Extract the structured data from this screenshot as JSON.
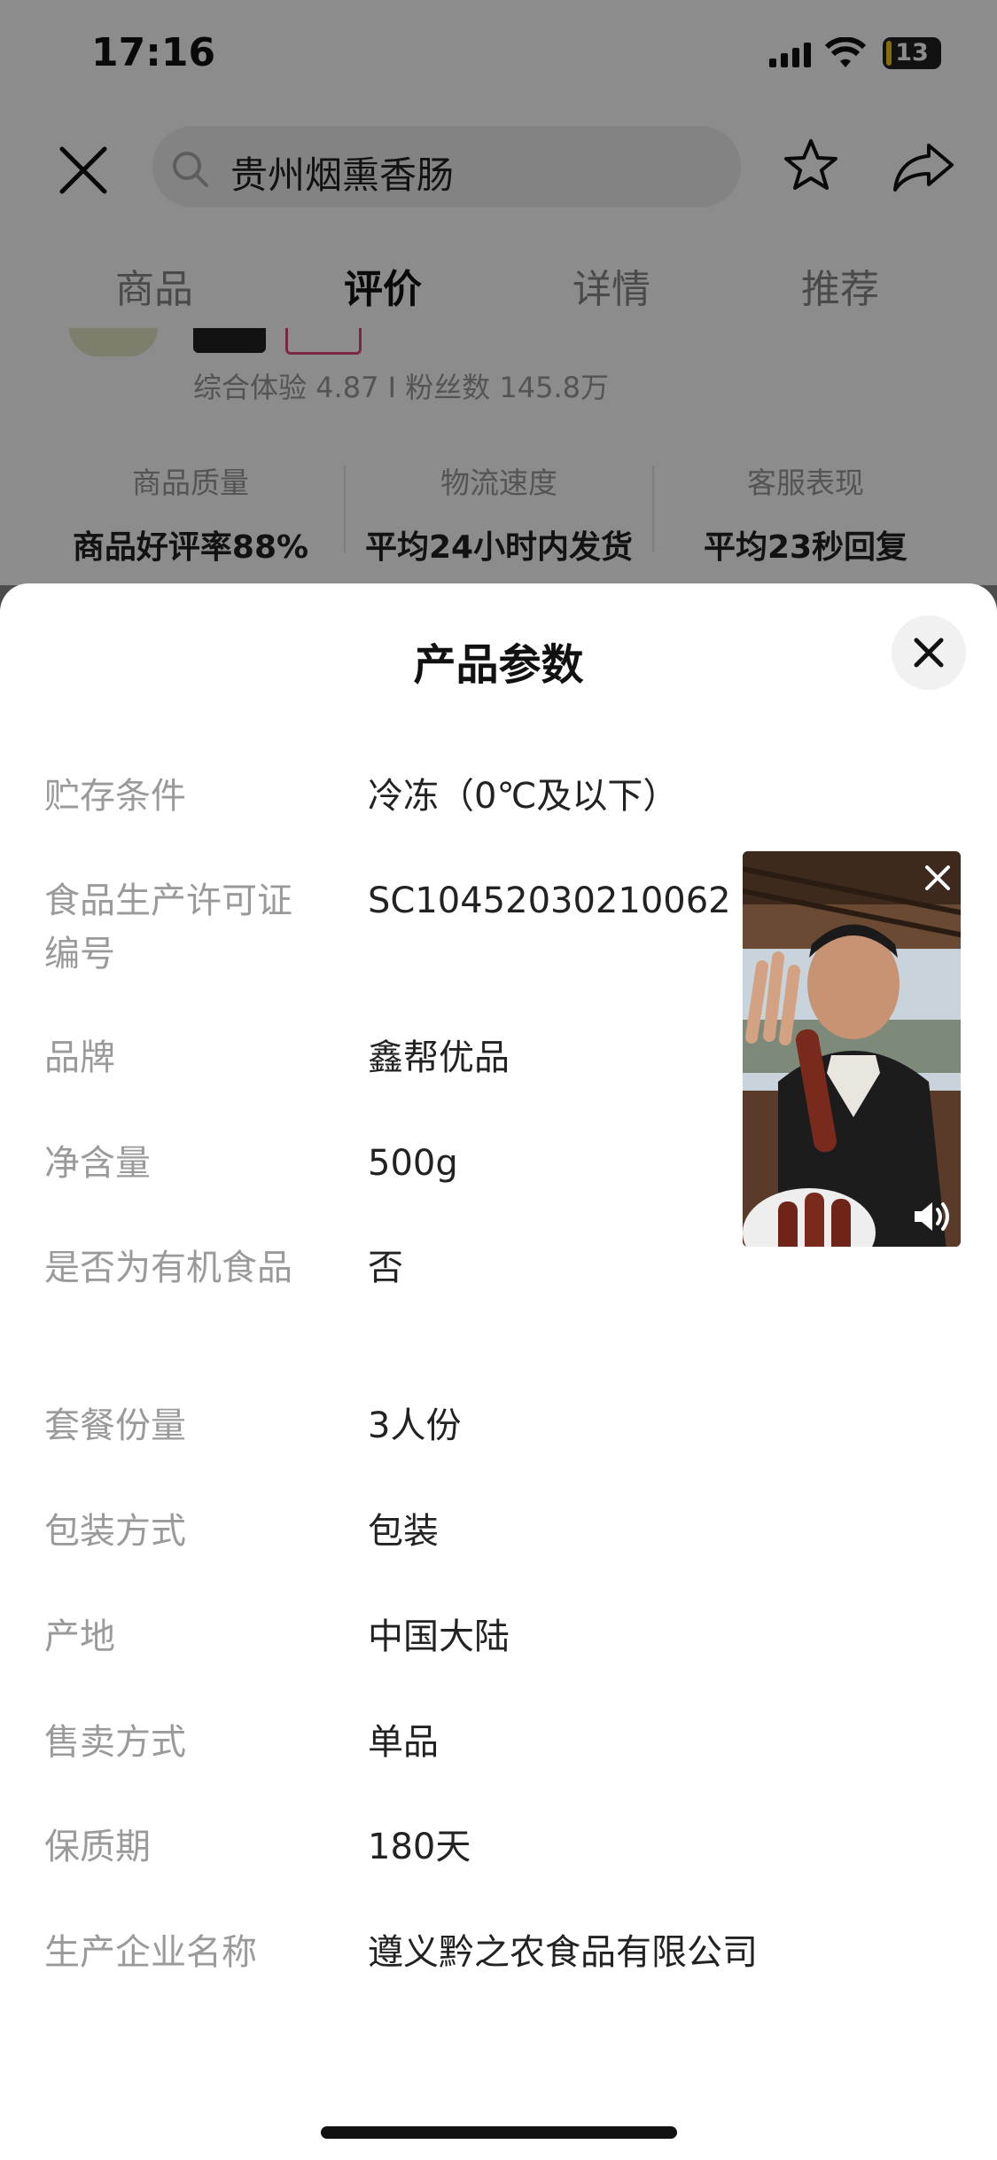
{
  "status": {
    "time": "17:16",
    "battery": "13"
  },
  "search": {
    "query": "贵州烟熏香肠"
  },
  "tabs": [
    {
      "label": "商品"
    },
    {
      "label": "评价"
    },
    {
      "label": "详情"
    },
    {
      "label": "推荐"
    }
  ],
  "shop": {
    "meta": "综合体验 4.87 I 粉丝数 145.8万",
    "metrics": [
      {
        "label": "商品质量",
        "value": "商品好评率88%"
      },
      {
        "label": "物流速度",
        "value": "平均24小时内发货"
      },
      {
        "label": "客服表现",
        "value": "平均23秒回复"
      }
    ]
  },
  "sheet": {
    "title": "产品参数",
    "params": [
      {
        "key": "贮存条件",
        "value": "冷冻（0℃及以下）"
      },
      {
        "key": "食品生产许可证编号",
        "value": "SC10452030210062"
      },
      {
        "key": "品牌",
        "value": "鑫帮优品"
      },
      {
        "key": "净含量",
        "value": "500g"
      },
      {
        "key": "是否为有机食品",
        "value": "否"
      },
      {
        "key": "套餐份量",
        "value": "3人份"
      },
      {
        "key": "包装方式",
        "value": "包装"
      },
      {
        "key": "产地",
        "value": "中国大陆"
      },
      {
        "key": "售卖方式",
        "value": "单品"
      },
      {
        "key": "保质期",
        "value": "180天"
      },
      {
        "key": "生产企业名称",
        "value": "遵义黔之农食品有限公司"
      }
    ]
  },
  "icons": {
    "close": "close-icon",
    "search": "search-icon",
    "favorite": "star-icon",
    "share": "share-icon",
    "sound": "speaker-icon"
  }
}
